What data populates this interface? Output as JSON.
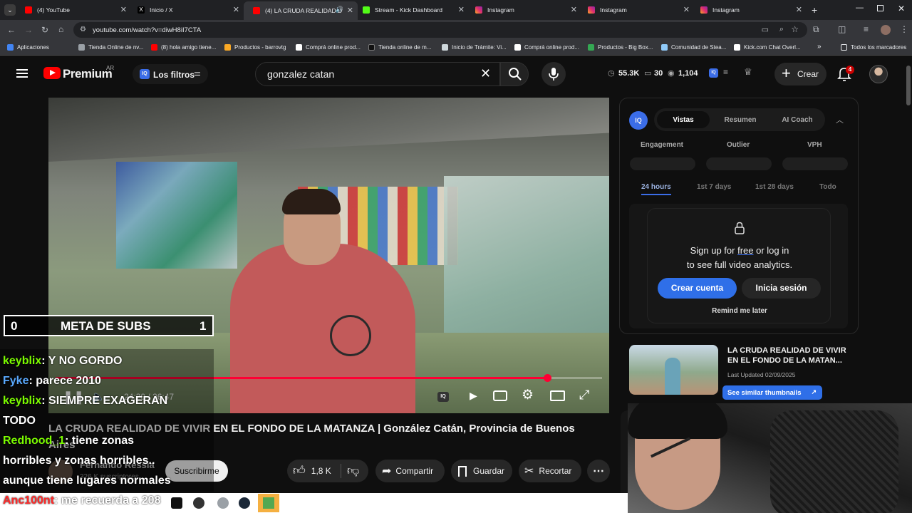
{
  "tabs": [
    {
      "title": "(4) YouTube",
      "color": "#ff0000"
    },
    {
      "title": "Inicio / X",
      "color": "#ffffff"
    },
    {
      "title": "(4) LA CRUDA REALIDAD D",
      "color": "#ff0000"
    },
    {
      "title": "Stream - Kick Dashboard",
      "color": "#53fc18"
    },
    {
      "title": "Instagram",
      "color": "#e1306c"
    },
    {
      "title": "Instagram",
      "color": "#e1306c"
    },
    {
      "title": "Instagram",
      "color": "#e1306c"
    }
  ],
  "url": "youtube.com/watch?v=diwH8iI7CTA",
  "bookmarks": [
    {
      "label": "Aplicaciones",
      "color": "#4285f4"
    },
    {
      "label": "Tienda Online de nv...",
      "color": "#9aa0a6"
    },
    {
      "label": "(8) hola amigo tiene...",
      "color": "#ff0000"
    },
    {
      "label": "Productos - barrovtg",
      "color": "#f9a825"
    },
    {
      "label": "Comprá online prod...",
      "color": "#ffffff"
    },
    {
      "label": "Tienda online de m...",
      "color": "#111111"
    },
    {
      "label": "Inicio de Trámite: Vi...",
      "color": "#cfd8dc"
    },
    {
      "label": "Comprá online prod...",
      "color": "#ffffff"
    },
    {
      "label": "Productos - Big Box...",
      "color": "#34a853"
    },
    {
      "label": "Comunidad de Stea...",
      "color": "#90caf9"
    },
    {
      "label": "Kick.com Chat Overl...",
      "color": "#ffffff"
    }
  ],
  "bookmarks_all": "Todos los marcadores",
  "yt": {
    "brand": "Premium",
    "region": "AR",
    "filters": "Los filtros",
    "search_value": "gonzalez catan",
    "stats": {
      "subs": "55.3K",
      "videos": "30",
      "views": "1,104"
    },
    "create": "Crear",
    "notif_count": "4"
  },
  "panel": {
    "tabs": [
      "Vistas",
      "Resumen",
      "AI Coach"
    ],
    "metrics": [
      "Engagement",
      "Outlier",
      "VPH"
    ],
    "ranges": [
      "24 hours",
      "1st 7 days",
      "1st 28 days",
      "Todo"
    ],
    "popup_line1_a": "Sign up for ",
    "popup_free": "free",
    "popup_line1_b": " or log in",
    "popup_line2": "to see full video analytics.",
    "create_account": "Crear cuenta",
    "login": "Inicia sesión",
    "remind": "Remind me later"
  },
  "related": {
    "title": "LA CRUDA REALIDAD DE VIVIR EN EL FONDO DE LA MATAN...",
    "updated": "Last Updated 02/09/2025",
    "similar": "See similar thumbnails"
  },
  "video": {
    "time": "24:20 / 26:47",
    "progress": 0.9,
    "title_line1": "LA CRUDA REALIDAD DE VIVIR EN EL FONDO DE LA MATANZA | González Catán, Provincia de Buenos",
    "title_line2": "Aires",
    "channel": "Fernando Ressia",
    "subs": "326 K suscriptores",
    "subscribe": "Suscribirme",
    "likes": "1,8 K",
    "share": "Compartir",
    "save": "Guardar",
    "clip": "Recortar"
  },
  "overlay": {
    "meta_left": "0",
    "meta_label": "META DE SUBS",
    "meta_right": "1",
    "chat": [
      {
        "user": "keyblix",
        "color": "#7cfc00",
        "msg": "Y NO GORDO"
      },
      {
        "user": "Fyke",
        "color": "#5aa9ff",
        "msg": "parece 2010"
      },
      {
        "user": "keyblix",
        "color": "#7cfc00",
        "msg": "SIEMPRE EXAGERAN"
      },
      {
        "user": "",
        "color": "#ffffff",
        "msg": "TODO"
      },
      {
        "user": "Redhood_1",
        "color": "#7cfc00",
        "msg": "tiene zonas"
      },
      {
        "user": "",
        "color": "#ffffff",
        "msg": "horribles y zonas horribles.."
      },
      {
        "user": "",
        "color": "#ffffff",
        "msg": "aunque tiene lugares normales"
      },
      {
        "user": "Anc100nt",
        "color": "#ff2a2a",
        "msg": "me recuerda a 208"
      }
    ]
  }
}
